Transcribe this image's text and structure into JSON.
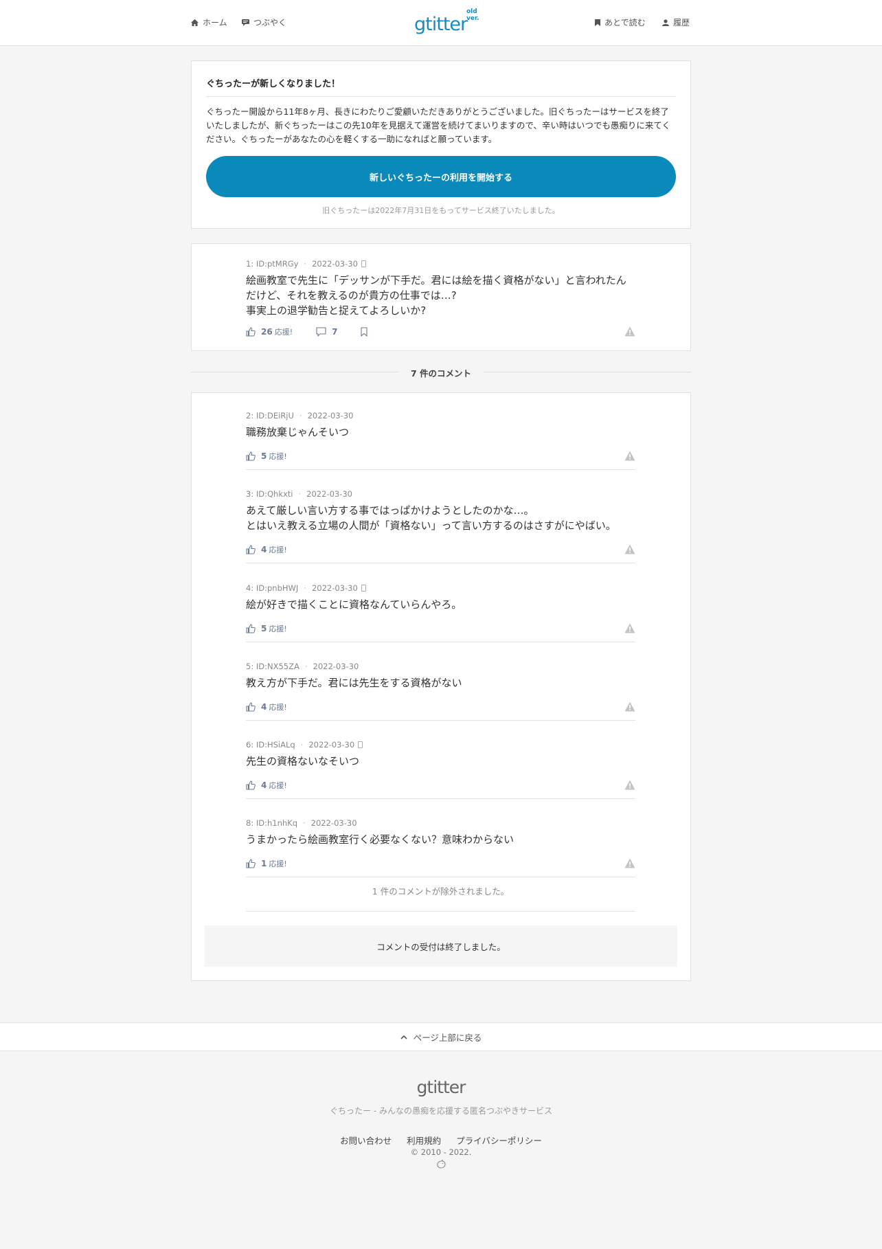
{
  "header": {
    "nav_left": [
      {
        "label": "ホーム",
        "icon": "home-icon"
      },
      {
        "label": "つぶやく",
        "icon": "speech-icon"
      }
    ],
    "logo": "gtitter",
    "logo_sub": "old ver.",
    "nav_right": [
      {
        "label": "あとで読む",
        "icon": "bookmark-icon"
      },
      {
        "label": "履歴",
        "icon": "person-icon"
      }
    ]
  },
  "notice": {
    "title": "ぐちったーが新しくなりました！",
    "body": "ぐちったー開設から11年8ヶ月、長きにわたりご愛顧いただきありがとうございました。旧ぐちったーはサービスを終了いたしましたが、新ぐちったーはこの先10年を見据えて運営を続けてまいりますので、辛い時はいつでも愚痴りに来てください。ぐちったーがあなたの心を軽くする一助になればと願っています。",
    "button": "新しいぐちったーの利用を開始する",
    "end_note": "旧ぐちったーは2022年7月31日をもってサービス終了いたしました。"
  },
  "main_post": {
    "num": "1:",
    "id": "ID:ptMRGy",
    "date": "2022-03-30",
    "lines": [
      "絵画教室で先生に「デッサンが下手だ。君には絵を描く資格がない」と言われたん",
      "だけど、それを教えるのが貴方の仕事では…?",
      "事実上の退学勧告と捉えてよろしいか?"
    ],
    "likes": "26",
    "like_label": "応援!",
    "comments": "7"
  },
  "comments_heading": "7 件のコメント",
  "comments": [
    {
      "num": "2:",
      "id": "ID:DEiRjU",
      "date": "2022-03-30",
      "phone": false,
      "lines": [
        "職務放棄じゃんそいつ"
      ],
      "likes": "5"
    },
    {
      "num": "3:",
      "id": "ID:Qhkxti",
      "date": "2022-03-30",
      "phone": false,
      "lines": [
        "あえて厳しい言い方する事ではっぱかけようとしたのかな…。",
        "とはいえ教える立場の人間が「資格ない」って言い方するのはさすがにやばい。"
      ],
      "likes": "4"
    },
    {
      "num": "4:",
      "id": "ID:pnbHWJ",
      "date": "2022-03-30",
      "phone": true,
      "lines": [
        "絵が好きで描くことに資格なんていらんやろ。"
      ],
      "likes": "5"
    },
    {
      "num": "5:",
      "id": "ID:NX55ZA",
      "date": "2022-03-30",
      "phone": false,
      "lines": [
        "教え方が下手だ。君には先生をする資格がない"
      ],
      "likes": "4"
    },
    {
      "num": "6:",
      "id": "ID:HSiALq",
      "date": "2022-03-30",
      "phone": true,
      "lines": [
        "先生の資格ないなそいつ"
      ],
      "likes": "4"
    },
    {
      "num": "8:",
      "id": "ID:h1nhKq",
      "date": "2022-03-30",
      "phone": false,
      "lines": [
        "うまかったら絵画教室行く必要なくない？意味わからない"
      ],
      "likes": "1"
    }
  ],
  "like_label": "応援!",
  "removed_note": "1 件のコメントが除外されました。",
  "closed_note": "コメントの受付は終了しました。",
  "back_to_top": "ページ上部に戻る",
  "footer": {
    "logo": "gtitter",
    "tagline": "ぐちったー - みんなの愚痴を応援する匿名つぶやきサービス",
    "links": [
      "お問い合わせ",
      "利用規約",
      "プライバシーポリシー"
    ],
    "copyright": "© 2010 - 2022."
  }
}
